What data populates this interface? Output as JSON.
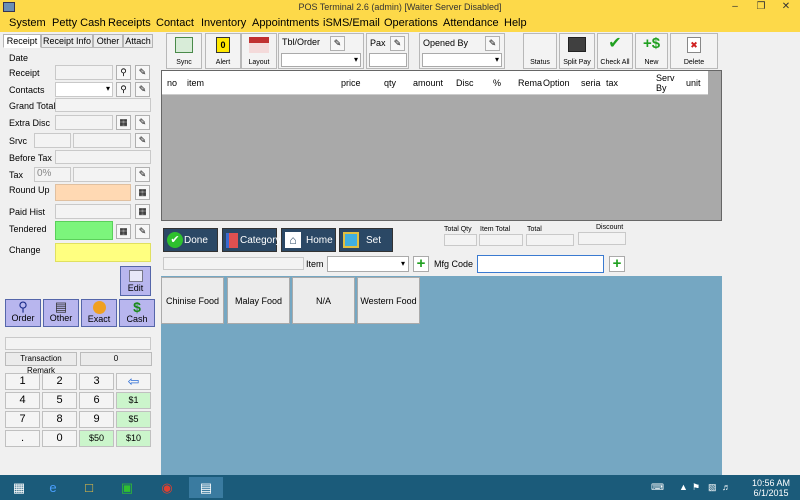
{
  "window": {
    "title": "POS Terminal 2.6 (admin) [Waiter Server Disabled]",
    "minimize": "–",
    "maximize": "❐",
    "close": "✕"
  },
  "menu": [
    "System",
    "Petty Cash",
    "Receipts",
    "Contact",
    "Inventory",
    "Appointments",
    "iSMS/Email",
    "Operations",
    "Attendance",
    "Help"
  ],
  "left_tabs": [
    "Receipt",
    "Receipt Info",
    "Other",
    "Attach"
  ],
  "fields": {
    "date": "Date",
    "receipt": "Receipt",
    "contacts": "Contacts",
    "grand_total": "Grand Total",
    "extra_disc": "Extra Disc",
    "srvc": "Srvc",
    "before_tax": "Before Tax",
    "tax": "Tax",
    "tax_value": "0%",
    "round_up": "Round Up",
    "paid_hist": "Paid Hist",
    "tendered": "Tendered",
    "change": "Change",
    "edit": "Edit"
  },
  "payment": [
    "Order",
    "Other",
    "Exact",
    "Cash"
  ],
  "transaction": {
    "remark_label": "Transaction Remark",
    "remark_value": "0"
  },
  "keypad": [
    [
      "1",
      "2",
      "3",
      "⇦"
    ],
    [
      "4",
      "5",
      "6",
      "$1"
    ],
    [
      "7",
      "8",
      "9",
      "$5"
    ],
    [
      ".",
      "0",
      "$50",
      "$10"
    ]
  ],
  "toolbar": {
    "sync": "Sync",
    "alert": "Alert",
    "alert_badge": "0",
    "layout": "Layout",
    "tbl_order": "Tbl/Order",
    "pax": "Pax",
    "opened_by": "Opened By",
    "status": "Status",
    "split_pay": "Split Pay",
    "check_all": "Check All",
    "new": "New",
    "delete": "Delete"
  },
  "columns": [
    "no",
    "item",
    "price",
    "qty",
    "amount",
    "Disc",
    "%",
    "Rema",
    "Option",
    "seria",
    "tax",
    "",
    "Serv By",
    "unit"
  ],
  "actions": {
    "done": "Done",
    "category": "Category",
    "home": "Home",
    "set": "Set"
  },
  "totals": {
    "total_qty": "Total Qty",
    "item_total": "Item Total",
    "total": "Total",
    "discount": "Discount"
  },
  "item_row": {
    "item_label": "Item",
    "mfg_label": "Mfg Code"
  },
  "categories": [
    "Chinise Food",
    "Malay Food",
    "N/A",
    "Western Food"
  ],
  "tray": {
    "time": "10:56 AM",
    "date": "6/1/2015"
  },
  "colors": {
    "title_bar": "#fdd949",
    "grid_bg": "#a9a9a9",
    "category_bg": "#75a7c2",
    "round_up": "#ffd9b3",
    "tendered": "#7cf57c",
    "change": "#ffff80",
    "taskbar": "#1b5b7a"
  }
}
